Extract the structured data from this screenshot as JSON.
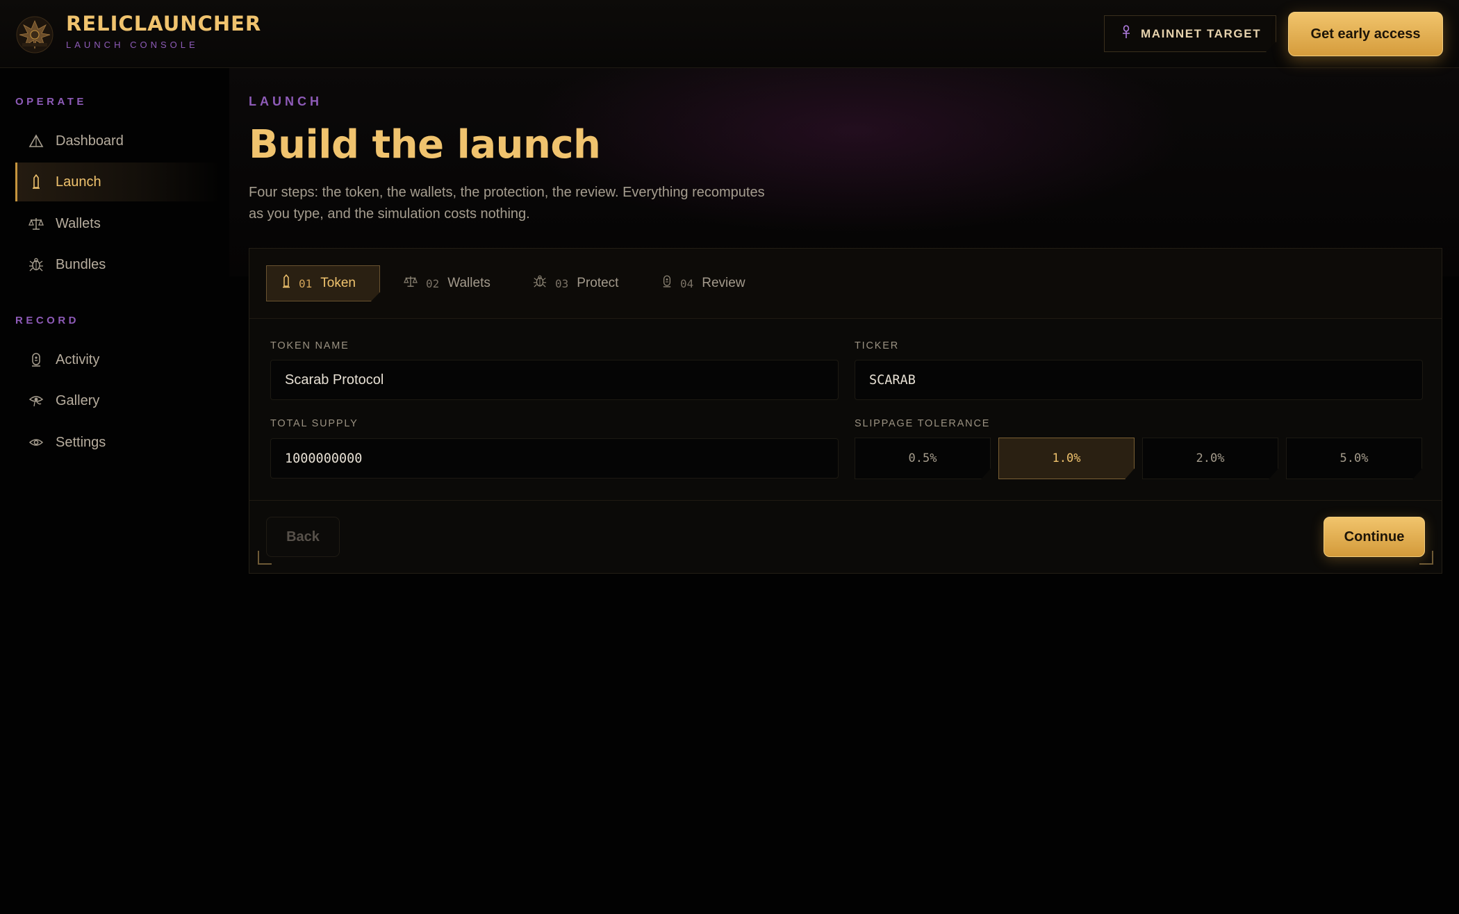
{
  "brand": {
    "title": "RELICLAUNCHER",
    "subtitle": "LAUNCH CONSOLE",
    "logo_text": "RELIC LAUNCHER"
  },
  "header": {
    "network_icon": "ankh-icon",
    "network_label": "MAINNET TARGET",
    "cta_label": "Get early access"
  },
  "sidebar": {
    "sections": [
      {
        "heading": "OPERATE",
        "items": [
          {
            "label": "Dashboard",
            "icon": "pyramid-icon",
            "active": false
          },
          {
            "label": "Launch",
            "icon": "obelisk-icon",
            "active": true
          },
          {
            "label": "Wallets",
            "icon": "scales-icon",
            "active": false
          },
          {
            "label": "Bundles",
            "icon": "scarab-icon",
            "active": false
          }
        ]
      },
      {
        "heading": "RECORD",
        "items": [
          {
            "label": "Activity",
            "icon": "cartouche-icon",
            "active": false
          },
          {
            "label": "Gallery",
            "icon": "eye-of-horus-icon",
            "active": false
          },
          {
            "label": "Settings",
            "icon": "eye-icon",
            "active": false
          }
        ]
      }
    ]
  },
  "main": {
    "eyebrow": "LAUNCH",
    "title": "Build the launch",
    "description": "Four steps: the token, the wallets, the protection, the review. Everything recomputes as you type, and the simulation costs nothing."
  },
  "wizard": {
    "tabs": [
      {
        "num": "01",
        "label": "Token",
        "icon": "obelisk-icon",
        "active": true
      },
      {
        "num": "02",
        "label": "Wallets",
        "icon": "scales-icon",
        "active": false
      },
      {
        "num": "03",
        "label": "Protect",
        "icon": "scarab-icon",
        "active": false
      },
      {
        "num": "04",
        "label": "Review",
        "icon": "cartouche-icon",
        "active": false
      }
    ],
    "fields": {
      "token_name": {
        "label": "TOKEN NAME",
        "value": "Scarab Protocol"
      },
      "ticker": {
        "label": "TICKER",
        "value": "SCARAB"
      },
      "total_supply": {
        "label": "TOTAL SUPPLY",
        "value": "1000000000"
      },
      "slippage": {
        "label": "SLIPPAGE TOLERANCE",
        "options": [
          "0.5%",
          "1.0%",
          "2.0%",
          "5.0%"
        ],
        "selected": "1.0%"
      }
    },
    "back_label": "Back",
    "continue_label": "Continue"
  },
  "colors": {
    "accent_gold": "#f0c36e",
    "accent_purple": "#8e5bb8",
    "background": "#020202"
  }
}
